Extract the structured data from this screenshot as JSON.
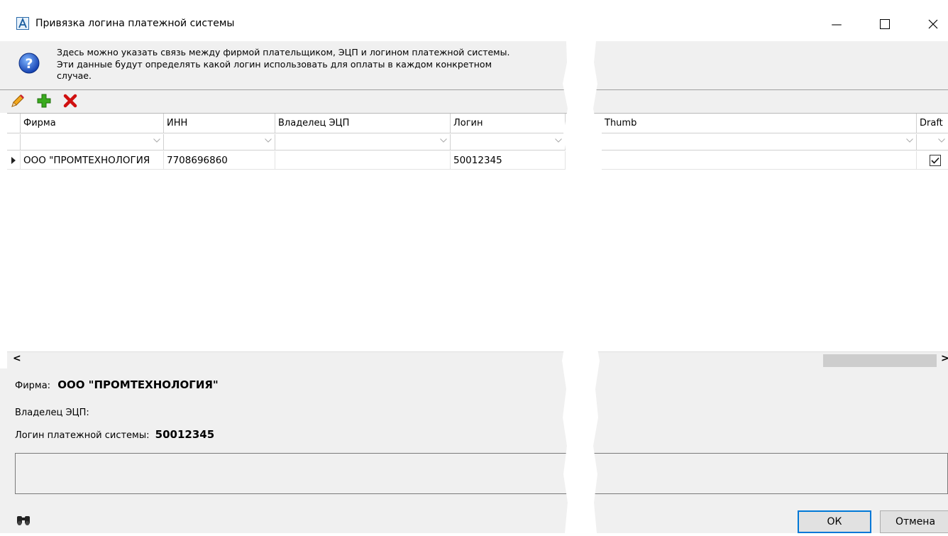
{
  "window": {
    "title": "Привязка логина платежной системы",
    "minimize_glyph": "—",
    "maximize_glyph": "☐",
    "close_glyph": "✕"
  },
  "info": {
    "text_line1": "Здесь можно указать связь между фирмой плательщиком, ЭЦП и логином платежной системы.",
    "text_line2": "Эти данные будут определять какой логин использовать для оплаты в каждом конкретном",
    "text_line3": "случае.",
    "icon": "question-icon"
  },
  "toolbar": {
    "items": [
      "edit-icon",
      "add-icon",
      "delete-icon"
    ]
  },
  "grid": {
    "columns": [
      "Фирма",
      "ИНН",
      "Владелец ЭЦП",
      "Логин",
      "Thumb",
      "Draft"
    ],
    "rows": [
      {
        "firma": "ООО \"ПРОМТЕХНОЛОГИЯ",
        "inn": "7708696860",
        "owner": "",
        "login": "50012345",
        "thumb": "",
        "draft": true
      }
    ],
    "scroll_left_glyph": "<",
    "scroll_right_glyph": ">"
  },
  "details": {
    "firma_label": "Фирма:",
    "firma_value": "ООО \"ПРОМТЕХНОЛОГИЯ\"",
    "owner_label": "Владелец ЭЦП:",
    "owner_value": "",
    "login_label": "Логин платежной системы:",
    "login_value": "50012345"
  },
  "footer": {
    "ok_label": "ОК",
    "cancel_label": "Отмена",
    "search_icon": "binoculars-icon"
  },
  "colors": {
    "accent": "#0078d7",
    "panel": "#f0f0f0",
    "delete": "#d01010",
    "add": "#3aaa1e"
  }
}
